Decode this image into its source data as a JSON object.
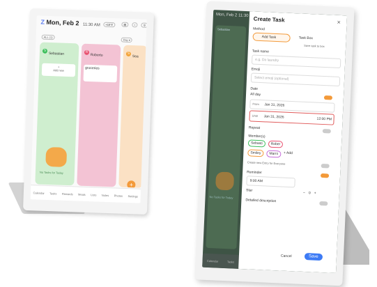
{
  "left": {
    "header": {
      "day": "Mon, Feb 2",
      "time": "11:30 AM",
      "badge": "+10°F"
    },
    "filter_chip": "ALL (1)",
    "view_chip": "Day ▾",
    "members": [
      {
        "initial": "S",
        "name": "Sebastian",
        "color": "#3cbf5b"
      },
      {
        "initial": "R",
        "name": "Roberto",
        "color": "#e8516f"
      },
      {
        "initial": "S",
        "name": "Sea",
        "color": "#f3a43a"
      }
    ],
    "add_new": "Add new",
    "task_title": "groceries",
    "no_tasks": "No Tasks for Today",
    "nav": [
      "Calendar",
      "Tasks",
      "Rewards",
      "Meals",
      "Lists",
      "Notes",
      "Photos",
      "Settings"
    ]
  },
  "right": {
    "header": {
      "day": "Mon, Feb 2",
      "time": "11:30"
    },
    "behind_member": "Sebastian",
    "behind_no_tasks": "No Tasks for Today",
    "dialog": {
      "title": "Create Task",
      "close": "×",
      "method_label": "Method",
      "method_add": "Add Task",
      "method_box": "Task Box",
      "save_to_box": "Save task to box",
      "task_name_label": "Task name",
      "task_name_placeholder": "e.g. Do laundry",
      "emoji_label": "Emoji",
      "emoji_placeholder": "Select emoji (optional)",
      "date_label": "Date",
      "all_day": "All day",
      "from_label": "From",
      "from_date": "Jan 31, 2026",
      "until_label": "Until",
      "until_date": "Jan 31, 2026",
      "until_time": "12:00 PM",
      "repeat_label": "Repeat",
      "members_label": "Member(s)",
      "member_1": "Sebasti",
      "member_2": "Rober",
      "member_3": "Smiley",
      "member_4": "Marni",
      "add_member": "+ Add",
      "separate_label": "Create new Entry for Everyone",
      "reminder_label": "Reminder",
      "reminder_time": "9:00 AM",
      "star_label": "Star",
      "star_value": "0",
      "desc_label": "Detailed description",
      "cancel": "Cancel",
      "save": "Save"
    },
    "nav": [
      "Calendar",
      "Tasks",
      "Rewards"
    ]
  }
}
